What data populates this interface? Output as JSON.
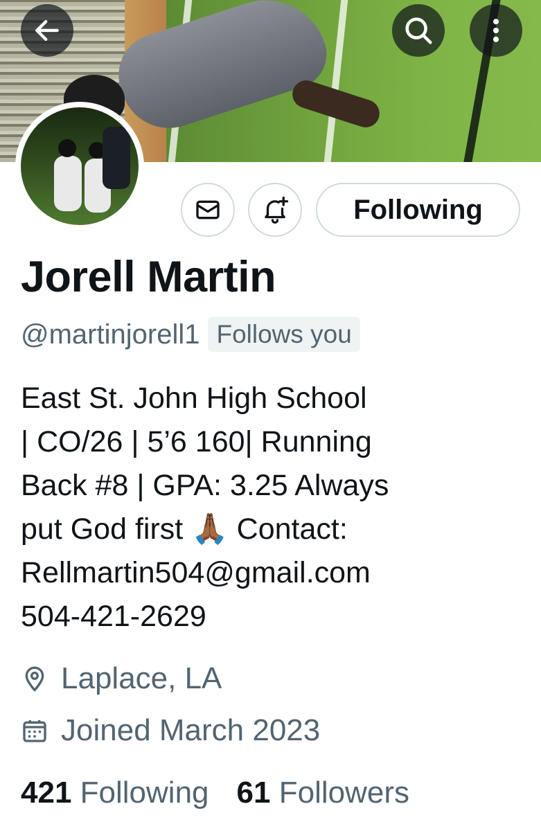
{
  "profile": {
    "name": "Jorell Martin",
    "handle": "@martinjorell1",
    "follows_you": "Follows you",
    "bio_lines": [
      "East St. John High School",
      "| CO/26 | 5’6 160| Running",
      "Back #8 | GPA: 3.25 Always",
      "put God first 🙏🏾 Contact:",
      "Rellmartin504@gmail.com",
      "504-421-2629"
    ],
    "location": "Laplace, LA",
    "joined": "Joined March 2023"
  },
  "actions": {
    "follow_label": "Following"
  },
  "stats": {
    "following_count": "421",
    "following_label": "Following",
    "followers_count": "61",
    "followers_label": "Followers"
  },
  "icons": {
    "back": "arrow-left-icon",
    "search": "search-icon",
    "more": "more-vertical-icon",
    "message": "envelope-icon",
    "notify": "bell-plus-icon",
    "location": "location-pin-icon",
    "calendar": "calendar-icon"
  },
  "colors": {
    "text_primary": "#0f1419",
    "text_secondary": "#536471",
    "border": "#cfd9de",
    "badge_bg": "#eff3f4"
  }
}
